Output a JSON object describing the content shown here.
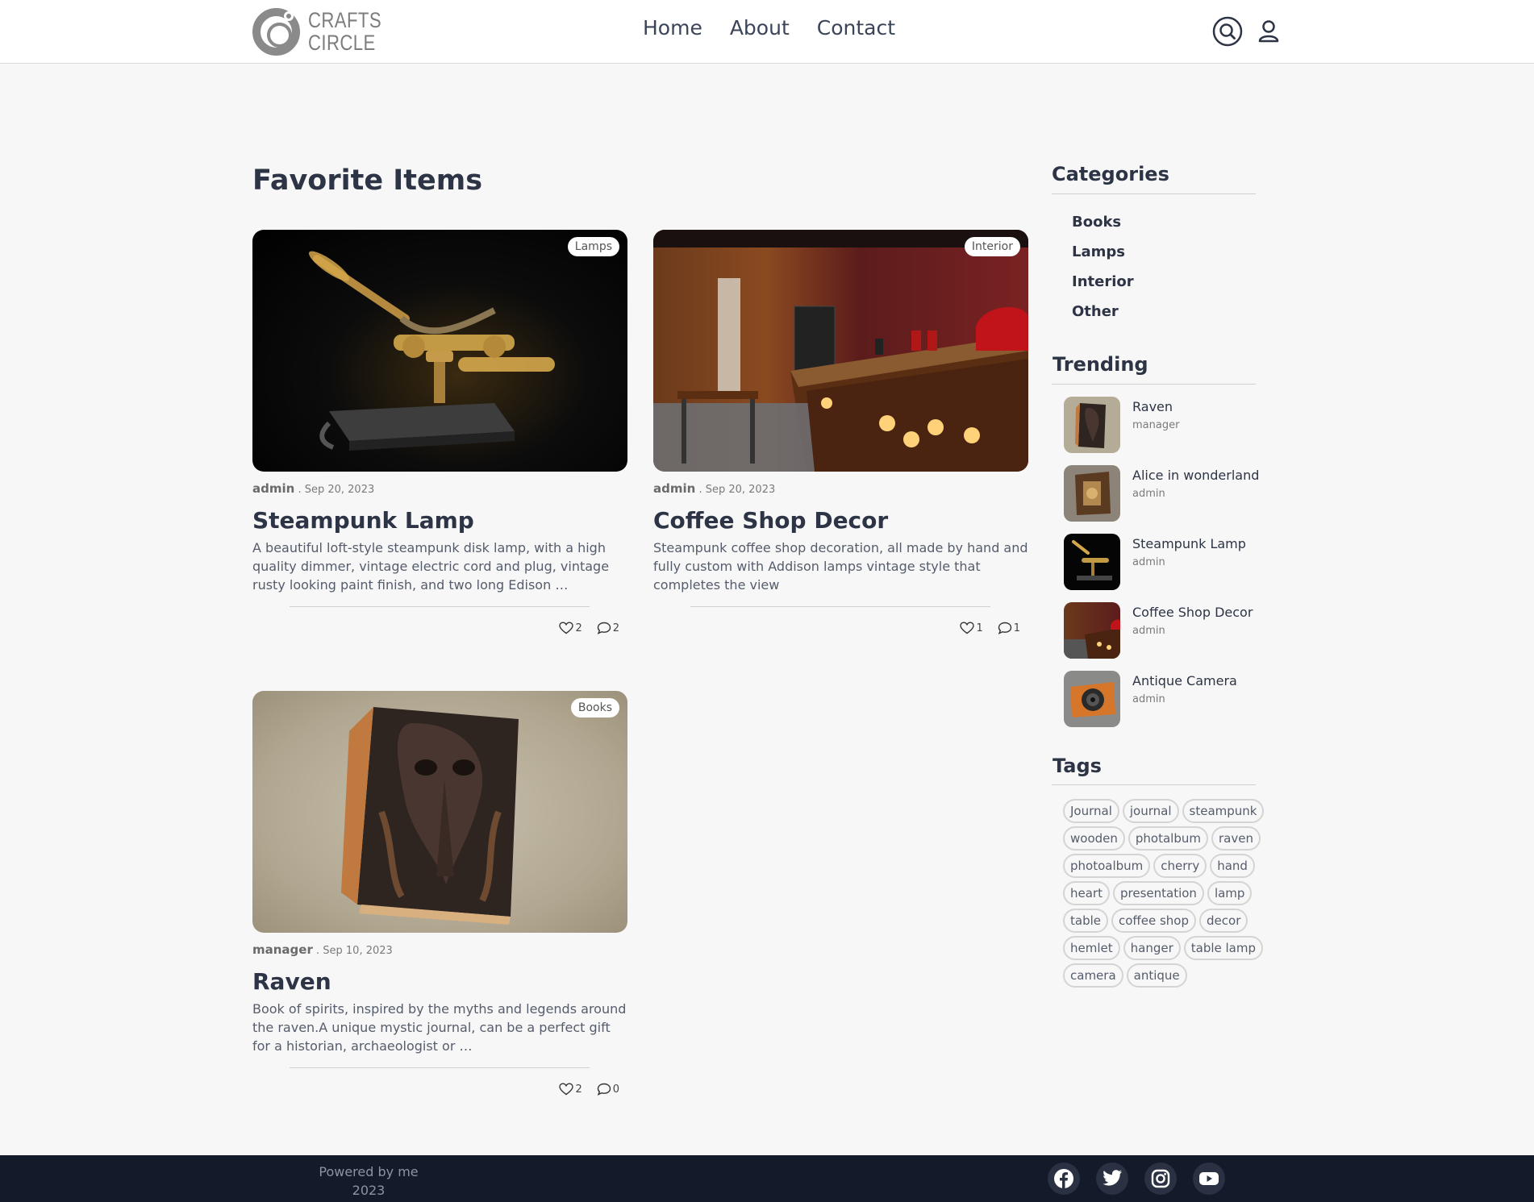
{
  "brand": {
    "line1": "CRAFTS",
    "line2": "CIRCLE"
  },
  "nav": {
    "home": "Home",
    "about": "About",
    "contact": "Contact"
  },
  "main": {
    "title": "Favorite Items"
  },
  "posts": [
    {
      "category": "Lamps",
      "author": "admin",
      "date": ". Sep 20, 2023",
      "title": "Steampunk Lamp",
      "excerpt": "A beautiful loft-style steampunk disk lamp, with a high quality dimmer, vintage electric cord and plug, vintage rusty looking paint finish, and two long Edison …",
      "likes": "2",
      "comments": "2"
    },
    {
      "category": "Interior",
      "author": "admin",
      "date": ". Sep 20, 2023",
      "title": "Coffee Shop Decor",
      "excerpt": "Steampunk coffee shop decoration, all made by hand and fully custom with Addison lamps vintage style that completes the view",
      "likes": "1",
      "comments": "1"
    },
    {
      "category": "Books",
      "author": "manager",
      "date": ". Sep 10, 2023",
      "title": "Raven",
      "excerpt": "Book of spirits, inspired by the myths and legends around the raven.A unique mystic journal, can be a perfect gift for a historian, archaeologist or …",
      "likes": "2",
      "comments": "0"
    }
  ],
  "sidebar": {
    "categories_heading": "Categories",
    "categories": [
      "Books",
      "Lamps",
      "Interior",
      "Other"
    ],
    "trending_heading": "Trending",
    "trending": [
      {
        "title": "Raven",
        "author": "manager"
      },
      {
        "title": "Alice in wonderland",
        "author": "admin"
      },
      {
        "title": "Steampunk Lamp",
        "author": "admin"
      },
      {
        "title": "Coffee Shop Decor",
        "author": "admin"
      },
      {
        "title": "Antique Camera",
        "author": "admin"
      }
    ],
    "tags_heading": "Tags",
    "tags": [
      "Journal",
      "journal",
      "steampunk",
      "wooden",
      "photalbum",
      "raven",
      "photoalbum",
      "cherry",
      "hand",
      "heart",
      "presentation",
      "lamp",
      "table",
      "coffee shop",
      "decor",
      "hemlet",
      "hanger",
      "table lamp",
      "camera",
      "antique"
    ]
  },
  "footer": {
    "line1": "Powered by me",
    "line2": "2023"
  },
  "social_icons": [
    "facebook-icon",
    "twitter-icon",
    "instagram-icon",
    "youtube-icon"
  ]
}
